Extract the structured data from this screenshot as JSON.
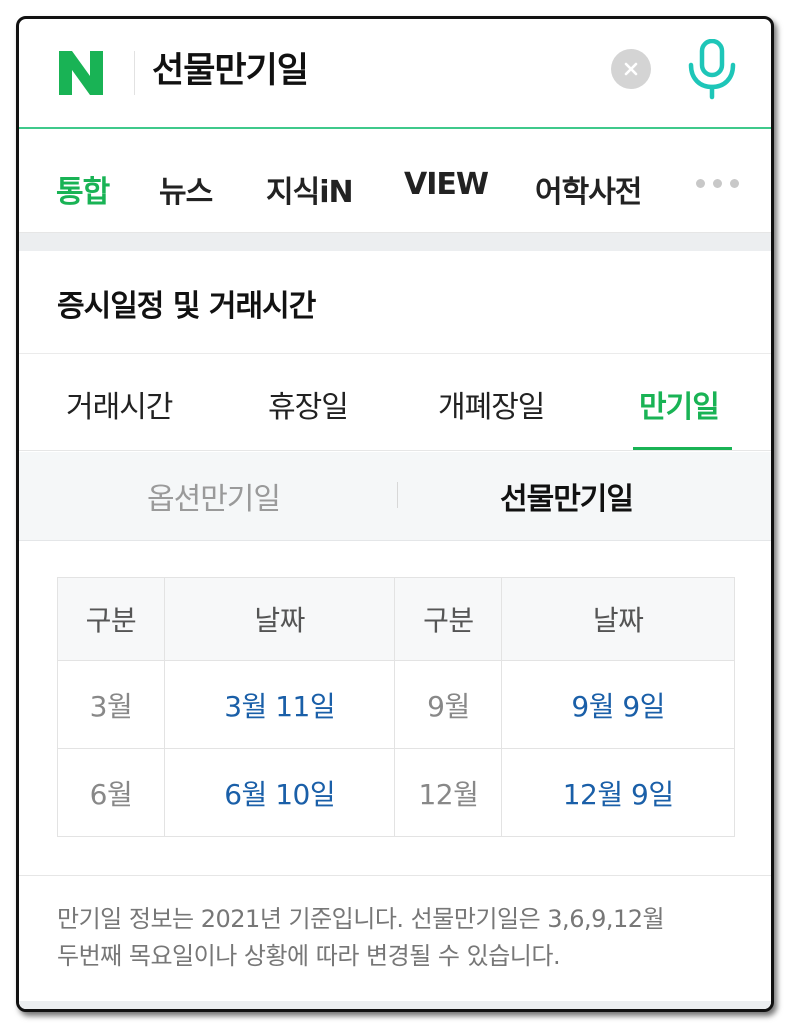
{
  "search": {
    "logo_letter": "N",
    "query": "선물만기일",
    "clear_icon": "close-icon",
    "mic_icon": "microphone-icon"
  },
  "colors": {
    "brand_green": "#19b355",
    "search_border": "#3fc98b",
    "link_blue": "#1a5fa8",
    "mic_teal": "#1ec6b8"
  },
  "tabs": [
    {
      "label": "통합",
      "active": true
    },
    {
      "label": "뉴스",
      "active": false
    },
    {
      "label": "지식iN",
      "active": false
    },
    {
      "label": "VIEW",
      "active": false
    },
    {
      "label": "어학사전",
      "active": false
    }
  ],
  "card": {
    "title": "증시일정 및 거래시간",
    "sub_tabs": [
      {
        "label": "거래시간",
        "active": false
      },
      {
        "label": "휴장일",
        "active": false
      },
      {
        "label": "개폐장일",
        "active": false
      },
      {
        "label": "만기일",
        "active": true
      }
    ],
    "segments": [
      {
        "label": "옵션만기일",
        "active": false
      },
      {
        "label": "선물만기일",
        "active": true
      }
    ],
    "table": {
      "headers": [
        "구분",
        "날짜",
        "구분",
        "날짜"
      ],
      "rows": [
        [
          "3월",
          "3월 11일",
          "9월",
          "9월 9일"
        ],
        [
          "6월",
          "6월 10일",
          "12월",
          "12월 9일"
        ]
      ]
    },
    "notice_line1": "만기일 정보는 2021년 기준입니다. 선물만기일은 3,6,9,12월",
    "notice_line2": "두번째 목요일이나 상황에 따라 변경될 수 있습니다."
  }
}
